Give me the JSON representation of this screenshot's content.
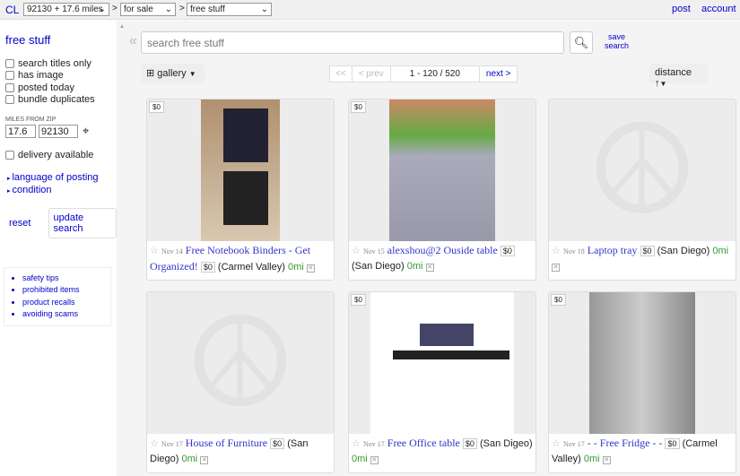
{
  "top": {
    "logo": "CL",
    "area": "92130 + 17.6 miles",
    "section": "for sale",
    "category": "free stuff",
    "post": "post",
    "account": "account",
    "sep": ">"
  },
  "side": {
    "title": "free stuff",
    "filters": [
      "search titles only",
      "has image",
      "posted today",
      "bundle duplicates"
    ],
    "miles_label": "MILES FROM ZIP",
    "miles": "17.6",
    "zip": "92130",
    "delivery": "delivery available",
    "links": [
      "language of posting",
      "condition"
    ],
    "reset": "reset",
    "update": "update search",
    "safety": [
      "safety tips",
      "prohibited items",
      "product recalls",
      "avoiding scams"
    ]
  },
  "main": {
    "search_placeholder": "search free stuff",
    "save": "save",
    "search_word": "search",
    "view": "gallery",
    "first": "<<",
    "prev": "< prev",
    "range": "1 - 120 / 520",
    "next": "next >",
    "sort": "distance ↑"
  },
  "listings": [
    {
      "price": "$0",
      "date": "Nov 14",
      "title": "Free Notebook Binders - Get Organized!",
      "pr": "$0",
      "loc": "(Carmel Valley)",
      "mi": "0mi"
    },
    {
      "price": "$0",
      "date": "Nov 15",
      "title": "alexshou@2 Ouside table",
      "pr": "$0",
      "loc": "(San Diego)",
      "mi": "0mi"
    },
    {
      "price": "",
      "date": "Nov 18",
      "title": "Laptop tray",
      "pr": "$0",
      "loc": "(San Diego)",
      "mi": "0mi"
    },
    {
      "price": "",
      "date": "Nov 17",
      "title": "House of Furniture",
      "pr": "$0",
      "loc": "(San Diego)",
      "mi": "0mi"
    },
    {
      "price": "$0",
      "date": "Nov 17",
      "title": "Free Office table",
      "pr": "$0",
      "loc": "(San Digeo)",
      "mi": "0mi"
    },
    {
      "price": "$0",
      "date": "Nov 17",
      "title": "- - Free Fridge - -",
      "pr": "$0",
      "loc": "(Carmel Valley)",
      "mi": "0mi"
    }
  ]
}
